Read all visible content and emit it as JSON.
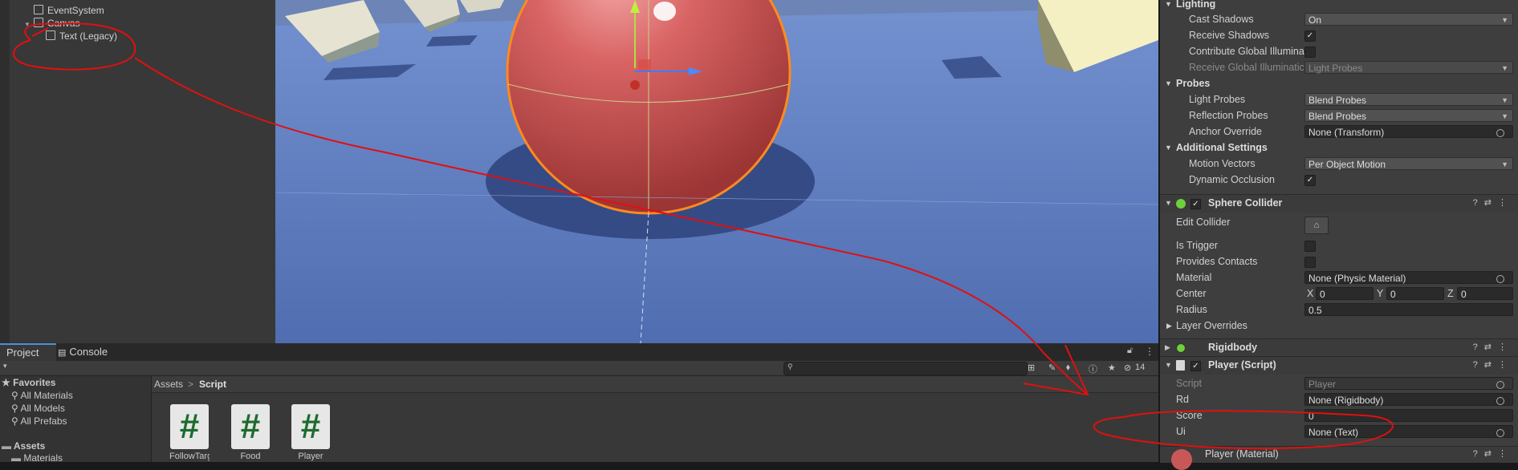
{
  "hierarchy": {
    "items": [
      {
        "label": "EventSystem"
      },
      {
        "label": "Canvas"
      },
      {
        "label": "Text (Legacy)"
      }
    ]
  },
  "project": {
    "tabs": [
      {
        "label": "Project"
      },
      {
        "label": "Console"
      }
    ],
    "hidden_count": "14",
    "favorites": {
      "title": "Favorites",
      "items": [
        "All Materials",
        "All Models",
        "All Prefabs"
      ]
    },
    "assets": {
      "title": "Assets",
      "children": [
        "Materials"
      ]
    },
    "breadcrumb": {
      "root": "Assets",
      "sep": ">",
      "current": "Script"
    },
    "files": [
      {
        "name": "FollowTarg...",
        "glyph": "#"
      },
      {
        "name": "Food",
        "glyph": "#"
      },
      {
        "name": "Player",
        "glyph": "#"
      }
    ],
    "search_placeholder": ""
  },
  "inspector": {
    "lighting": {
      "title": "Lighting",
      "cast_shadows": {
        "label": "Cast Shadows",
        "value": "On"
      },
      "receive_shadows": {
        "label": "Receive Shadows",
        "checked": "✓"
      },
      "contribute_gi": {
        "label": "Contribute Global Illumina"
      },
      "receive_gi": {
        "label": "Receive Global Illuminatic",
        "value": "Light Probes"
      }
    },
    "probes": {
      "title": "Probes",
      "light_probes": {
        "label": "Light Probes",
        "value": "Blend Probes"
      },
      "reflection_probes": {
        "label": "Reflection Probes",
        "value": "Blend Probes"
      },
      "anchor_override": {
        "label": "Anchor Override",
        "value": "None (Transform)"
      }
    },
    "additional": {
      "title": "Additional Settings",
      "motion_vectors": {
        "label": "Motion Vectors",
        "value": "Per Object Motion"
      },
      "dynamic_occlusion": {
        "label": "Dynamic Occlusion",
        "checked": "✓"
      }
    },
    "sphere_collider": {
      "title": "Sphere Collider",
      "edit_collider": "Edit Collider",
      "is_trigger": "Is Trigger",
      "provides_contacts": "Provides Contacts",
      "material": {
        "label": "Material",
        "value": "None (Physic Material)"
      },
      "center": {
        "label": "Center",
        "x_label": "X",
        "x": "0",
        "y_label": "Y",
        "y": "0",
        "z_label": "Z",
        "z": "0"
      },
      "radius": {
        "label": "Radius",
        "value": "0.5"
      },
      "layer_overrides": "Layer Overrides"
    },
    "rigidbody": {
      "title": "Rigidbody"
    },
    "player_script": {
      "title": "Player (Script)",
      "script": {
        "label": "Script",
        "value": "Player"
      },
      "rd": {
        "label": "Rd",
        "value": "None (Rigidbody)"
      },
      "score": {
        "label": "Score",
        "value": "0"
      },
      "ui": {
        "label": "Ui",
        "value": "None (Text)"
      }
    },
    "material": {
      "title": "Player (Material)"
    }
  },
  "colors": {
    "annotation": "#e01010",
    "selection_outline": "#ff8a1f",
    "scene_floor": "#5a7bbd",
    "tab_accent": "#4a90d9"
  }
}
